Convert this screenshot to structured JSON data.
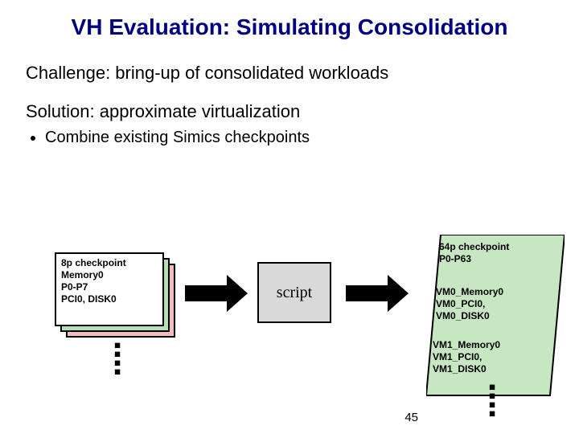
{
  "title": "VH Evaluation: Simulating Consolidation",
  "challenge": "Challenge:  bring-up of consolidated workloads",
  "solution": "Solution:  approximate virtualization",
  "bullet1": "Combine existing Simics checkpoints",
  "left_box": {
    "l1": "8p checkpoint",
    "l2": "Memory0",
    "l3": "P0-P7",
    "l4": "PCI0, DISK0"
  },
  "script_label": "script",
  "right_box": {
    "h1": "64p checkpoint",
    "h2": "P0-P63",
    "vm0_1": "VM0_Memory0",
    "vm0_2": "VM0_PCI0,",
    "vm0_3": "VM0_DISK0",
    "vm1_1": "VM1_Memory0",
    "vm1_2": "VM1_PCI0,",
    "vm1_3": "VM1_DISK0"
  },
  "vdots": "▪\n▪\n▪\n▪",
  "slide_number": "45"
}
